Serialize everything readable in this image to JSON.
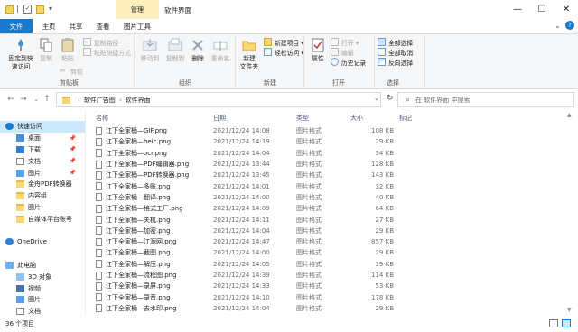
{
  "titlebar": {
    "context_tab": "管理",
    "title": "软件界面",
    "controls": [
      "—",
      "☐",
      "✕"
    ]
  },
  "tabs": [
    "文件",
    "主页",
    "共享",
    "查看",
    "图片工具"
  ],
  "ribbon": {
    "clipboard": {
      "pin": "固定到快\n速访问",
      "copy": "复制",
      "paste": "粘贴",
      "copy_path": "复制路径",
      "paste_shortcut": "粘贴快捷方式",
      "cut": "剪切",
      "label": "剪贴板"
    },
    "organize": {
      "move_to": "移动到",
      "copy_to": "复制到",
      "delete": "删除",
      "rename": "重命名",
      "label": "组织"
    },
    "new": {
      "new_folder": "新建\n文件夹",
      "new_item": "新建项目 ▾",
      "easy_access": "轻松访问 ▾",
      "label": "新建"
    },
    "open": {
      "properties": "属性",
      "open": "打开 ▾",
      "edit": "编辑",
      "history": "历史记录",
      "label": "打开"
    },
    "select": {
      "select_all": "全部选择",
      "select_none": "全部取消",
      "invert": "反向选择",
      "label": "选择"
    }
  },
  "address": {
    "path": [
      "软件广告图",
      "软件界面"
    ],
    "search_placeholder": "在 软件界面 中搜索"
  },
  "nav": {
    "items": [
      {
        "label": "快速访问",
        "pin": false
      },
      {
        "label": "桌面",
        "pin": true
      },
      {
        "label": "下载",
        "pin": true
      },
      {
        "label": "文档",
        "pin": true
      },
      {
        "label": "图片",
        "pin": true
      },
      {
        "label": "金舟PDF转换器",
        "pin": false
      },
      {
        "label": "内容组",
        "pin": false
      },
      {
        "label": "图片",
        "pin": false
      },
      {
        "label": "自媒体平台账号",
        "pin": false
      },
      {
        "label": "",
        "pin": false
      },
      {
        "label": "OneDrive",
        "pin": false
      },
      {
        "label": "",
        "pin": false
      },
      {
        "label": "此电脑",
        "pin": false
      },
      {
        "label": "3D 对象",
        "pin": false
      },
      {
        "label": "视频",
        "pin": false
      },
      {
        "label": "图片",
        "pin": false
      },
      {
        "label": "文档",
        "pin": false
      }
    ]
  },
  "columns": {
    "name": "名称",
    "date": "日期",
    "type": "类型",
    "size": "大小",
    "tags": "标记"
  },
  "files": [
    {
      "name": "江下全家桶—GIF.png",
      "date": "2021/12/24 14:08",
      "type": "图片格式",
      "size": "108 KB"
    },
    {
      "name": "江下全家桶—heic.png",
      "date": "2021/12/24 14:19",
      "type": "图片格式",
      "size": "29 KB"
    },
    {
      "name": "江下全家桶—ocr.png",
      "date": "2021/12/24 14:04",
      "type": "图片格式",
      "size": "34 KB"
    },
    {
      "name": "江下全家桶—PDF编辑器.png",
      "date": "2021/12/24 13:44",
      "type": "图片格式",
      "size": "128 KB"
    },
    {
      "name": "江下全家桶—PDF转换器.png",
      "date": "2021/12/24 13:45",
      "type": "图片格式",
      "size": "143 KB"
    },
    {
      "name": "江下全家桶—多账.png",
      "date": "2021/12/24 14:01",
      "type": "图片格式",
      "size": "32 KB"
    },
    {
      "name": "江下全家桶—翻译.png",
      "date": "2021/12/24 14:00",
      "type": "图片格式",
      "size": "40 KB"
    },
    {
      "name": "江下全家桶—格式工厂.png",
      "date": "2021/12/24 14:09",
      "type": "图片格式",
      "size": "64 KB"
    },
    {
      "name": "江下全家桶—关机.png",
      "date": "2021/12/24 14:11",
      "type": "图片格式",
      "size": "27 KB"
    },
    {
      "name": "江下全家桶—加密.png",
      "date": "2021/12/24 14:04",
      "type": "图片格式",
      "size": "29 KB"
    },
    {
      "name": "江下全家桶—江源网.png",
      "date": "2021/12/24 14:47",
      "type": "图片格式",
      "size": "857 KB"
    },
    {
      "name": "江下全家桶—截图.png",
      "date": "2021/12/24 14:00",
      "type": "图片格式",
      "size": "29 KB"
    },
    {
      "name": "江下全家桶—解压.png",
      "date": "2021/12/24 14:05",
      "type": "图片格式",
      "size": "39 KB"
    },
    {
      "name": "江下全家桶—流程图.png",
      "date": "2021/12/24 14:39",
      "type": "图片格式",
      "size": "114 KB"
    },
    {
      "name": "江下全家桶—录屏.png",
      "date": "2021/12/24 14:33",
      "type": "图片格式",
      "size": "53 KB"
    },
    {
      "name": "江下全家桶—录音.png",
      "date": "2021/12/24 14:10",
      "type": "图片格式",
      "size": "178 KB"
    },
    {
      "name": "江下全家桶—去水印.png",
      "date": "2021/12/24 14:04",
      "type": "图片格式",
      "size": "29 KB"
    }
  ],
  "status": {
    "count": "36 个项目"
  },
  "colors": {
    "file_tab": "#1979ca",
    "context_tab": "#fcefbd",
    "selected": "#cce8ff",
    "folder": "#f8d775"
  }
}
